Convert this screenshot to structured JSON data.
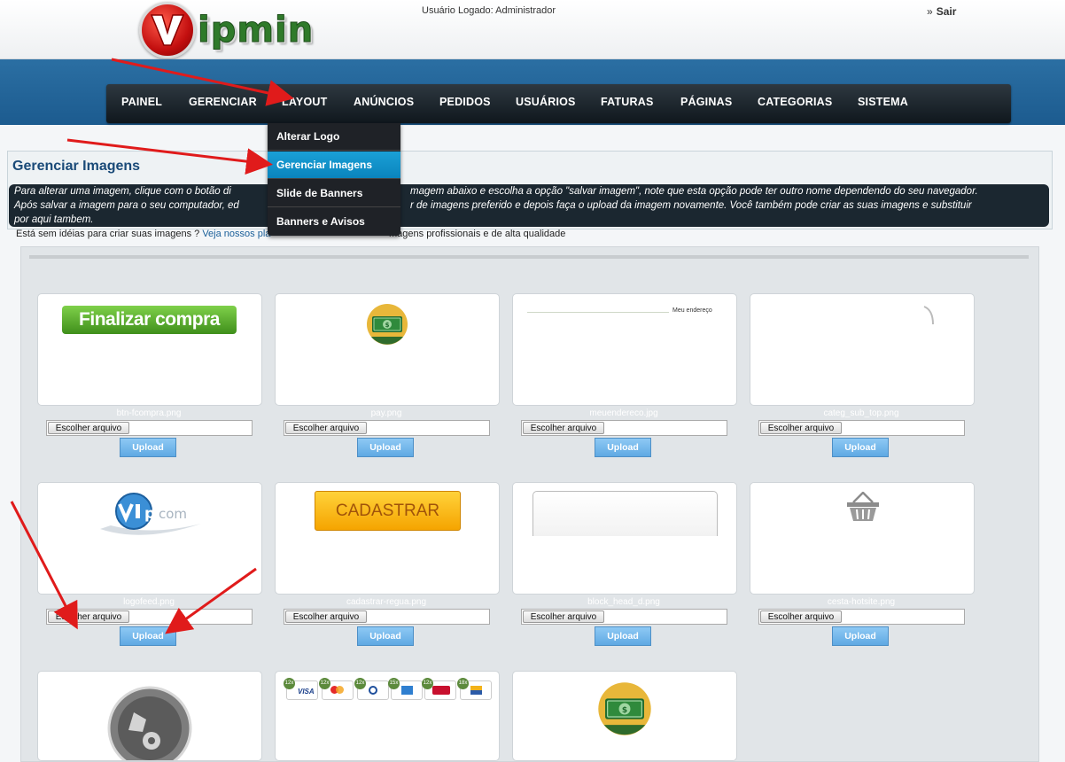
{
  "header": {
    "logo_text": "ipmin",
    "logged_label": "Usuário Logado: Administrador",
    "sair_prefix": "»",
    "sair_label": "Sair"
  },
  "nav": {
    "items": [
      "PAINEL",
      "GERENCIAR",
      "LAYOUT",
      "ANÚNCIOS",
      "PEDIDOS",
      "USUÁRIOS",
      "FATURAS",
      "PÁGINAS",
      "CATEGORIAS",
      "SISTEMA"
    ]
  },
  "dropdown": {
    "items": [
      "Alterar Logo",
      "Gerenciar Imagens",
      "Slide de Banners",
      "Banners e Avisos"
    ],
    "active_item": "Gerenciar Imagens"
  },
  "page": {
    "title": "Gerenciar Imagens",
    "info_line1": " Para alterar uma imagem, clique com o botão di",
    "info_line1b": "magem abaixo e escolha a opção \"salvar imagem\", note que esta opção pode ter outro nome dependendo do seu navegador.",
    "info_line2a": "Após salvar a imagem para o seu computador, ed",
    "info_line2b": "r de imagens preferido e depois faça o upload da imagem novamente. Você também pode criar as suas imagens e substituir",
    "info_line3": "por aqui tambem.",
    "tip_text": "Está sem idéias para criar suas imagens ?",
    "tip_link_a": "Veja nossos pla",
    "tip_link_b": "magens profissionais e de alta qualidade"
  },
  "images": [
    {
      "file": "btn-fcompra.png",
      "preview_text": "Finalizar compra"
    },
    {
      "file": "pay.png"
    },
    {
      "file": "meuendereco.jpg",
      "preview_text": "Meu endereço"
    },
    {
      "file": "categ_sub_top.png"
    },
    {
      "file": "logofeed.png",
      "preview_text": "com"
    },
    {
      "file": "cadastrar-regua.png",
      "preview_text": "CADASTRAR"
    },
    {
      "file": "block_head_d.png"
    },
    {
      "file": "cesta-hotsite.png"
    },
    {
      "file": ""
    },
    {
      "file": "",
      "badges": [
        "12x",
        "12x",
        "12x",
        "15x",
        "12x",
        "18x"
      ],
      "brands": [
        "VISA",
        "",
        "",
        "",
        "",
        "",
        ""
      ]
    },
    {
      "file": ""
    }
  ],
  "controls": {
    "choose_file_label": "Escolher arquivo",
    "upload_label": "Upload"
  },
  "colors": {
    "nav_bg": "#1b252d",
    "blue_band": "#2466a0",
    "dropdown_active": "#1198d2",
    "upload_button": "#6fb5ea",
    "title_blue": "#1a4a78",
    "annotation_arrow": "#e01b1b"
  }
}
